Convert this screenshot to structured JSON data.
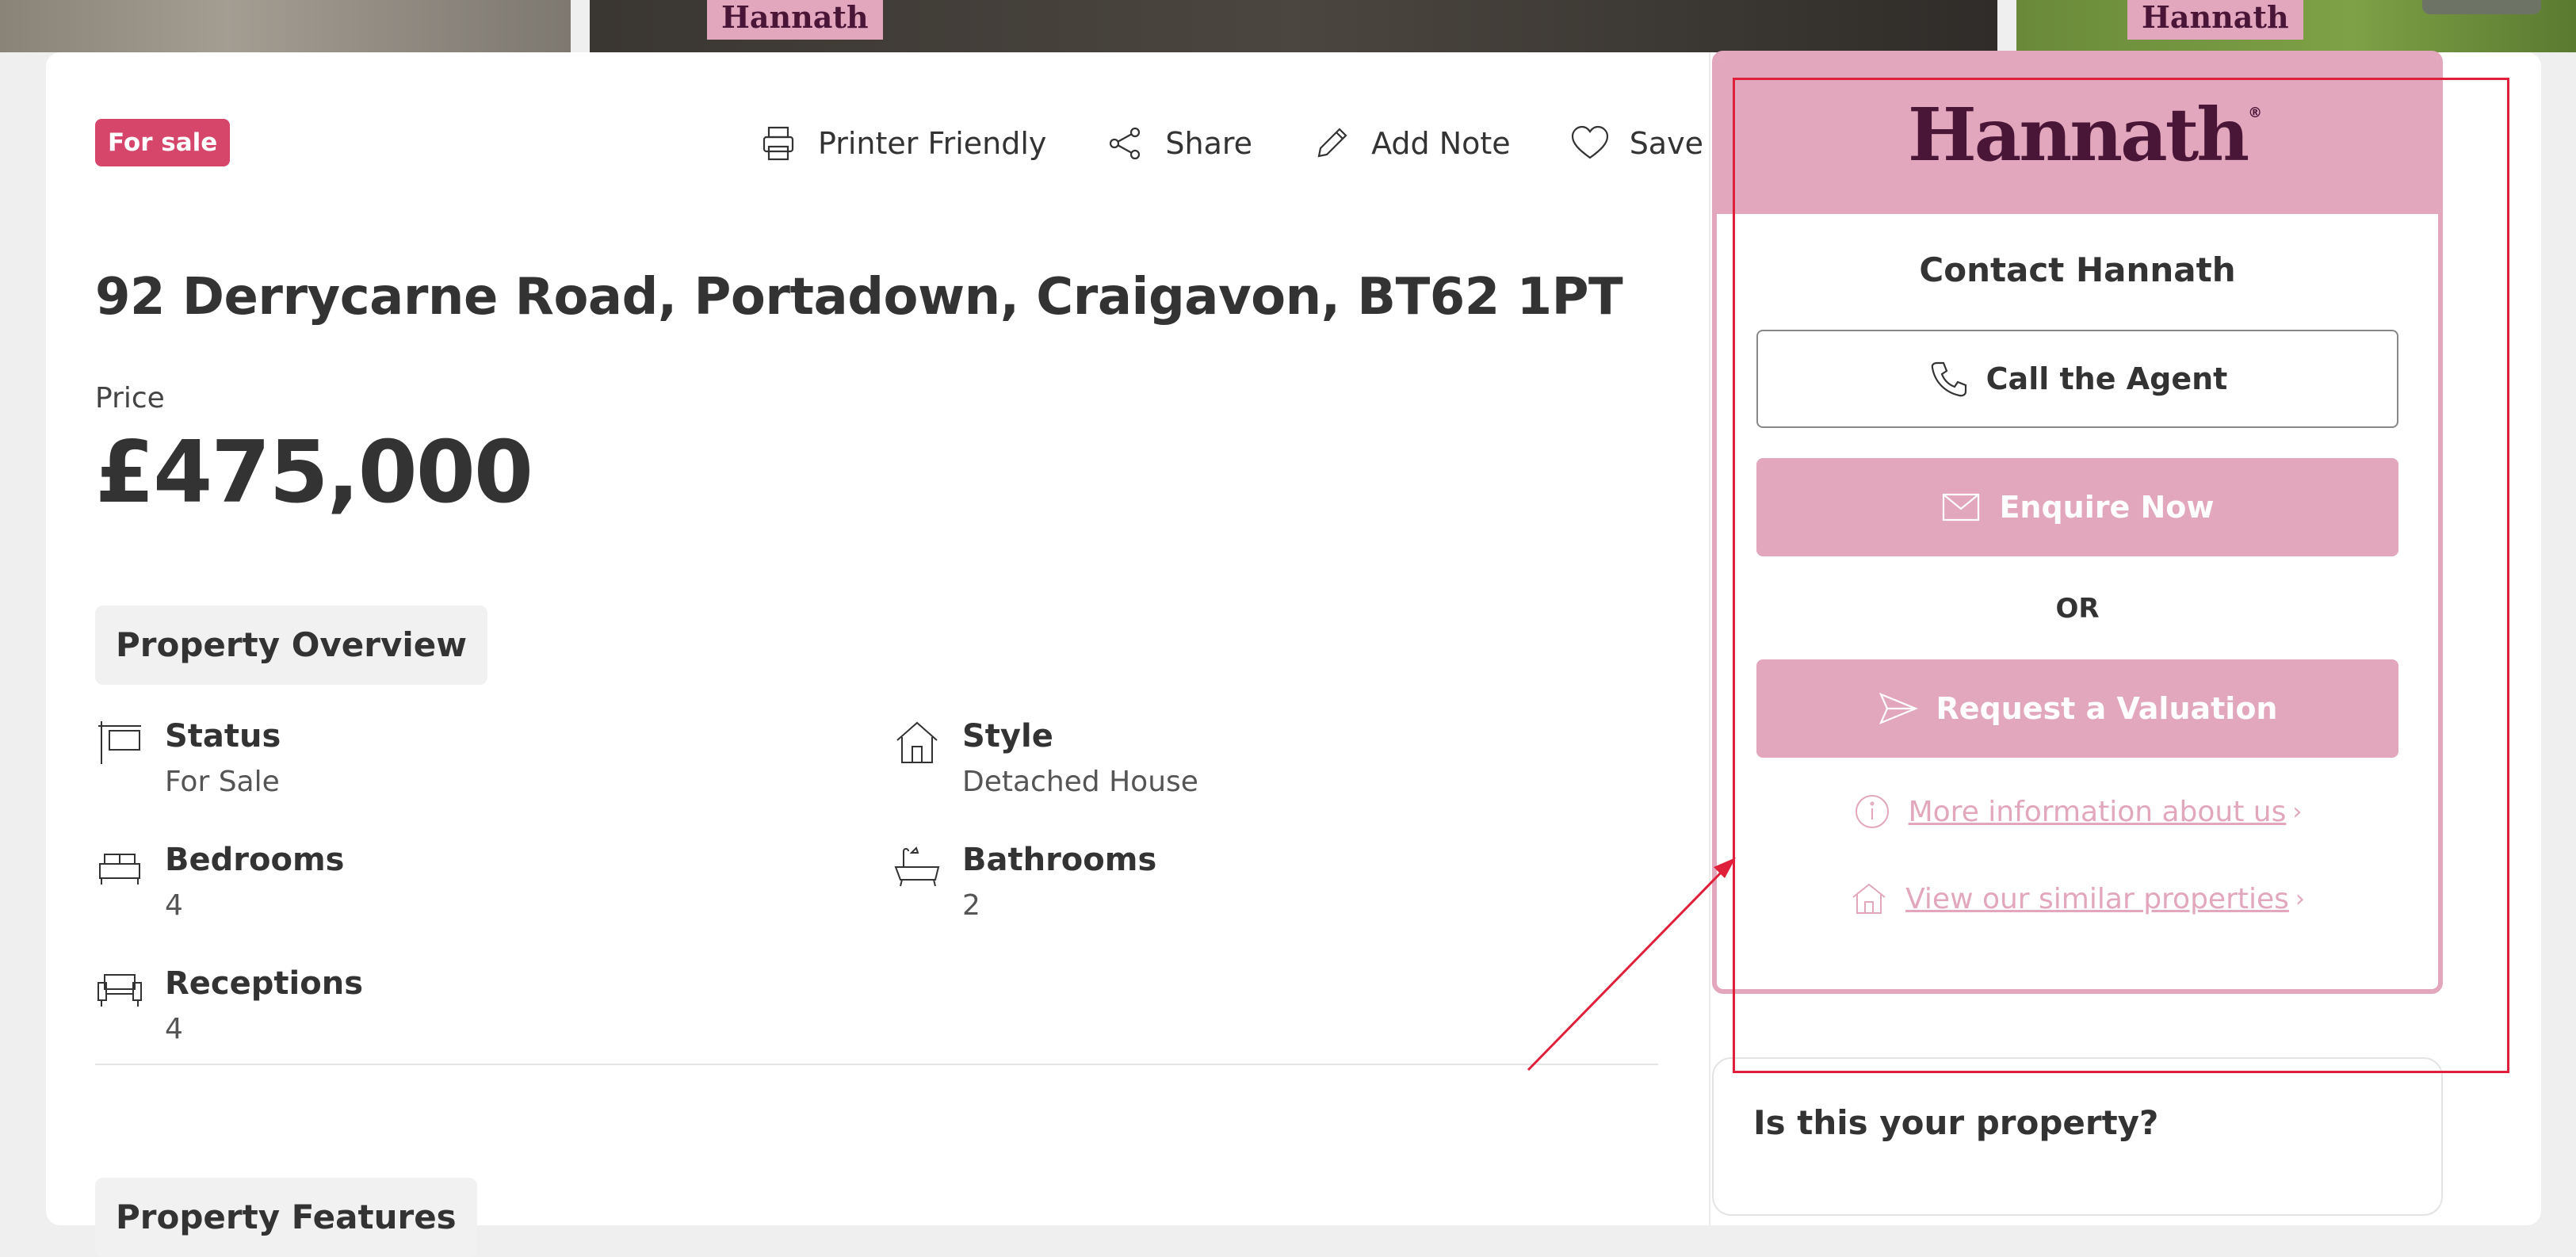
{
  "gallery": {
    "brand_badge": "Hannath"
  },
  "listing": {
    "status_badge": "For sale",
    "address": "92 Derrycarne Road, Portadown, Craigavon, BT62 1PT",
    "price_label": "Price",
    "price": "£475,000"
  },
  "actions": {
    "printer": "Printer Friendly",
    "share": "Share",
    "add_note": "Add Note",
    "save": "Save"
  },
  "overview": {
    "title": "Property Overview",
    "status_label": "Status",
    "status_value": "For Sale",
    "style_label": "Style",
    "style_value": "Detached House",
    "bedrooms_label": "Bedrooms",
    "bedrooms_value": "4",
    "bathrooms_label": "Bathrooms",
    "bathrooms_value": "2",
    "receptions_label": "Receptions",
    "receptions_value": "4"
  },
  "features": {
    "title": "Property Features"
  },
  "agent": {
    "logo": "Hannath",
    "logo_mark": "®",
    "title": "Contact Hannath",
    "call": "Call the Agent",
    "enquire": "Enquire Now",
    "or": "OR",
    "valuation": "Request a Valuation",
    "more_info": "More information about us",
    "similar": "View our similar properties",
    "chevron": "›"
  },
  "own": {
    "title": "Is this your property?"
  },
  "colors": {
    "brand_pink": "#e2a7bd",
    "brand_plum": "#4a1638",
    "sale_red": "#d6466a",
    "annotation_red": "#e0203a"
  }
}
